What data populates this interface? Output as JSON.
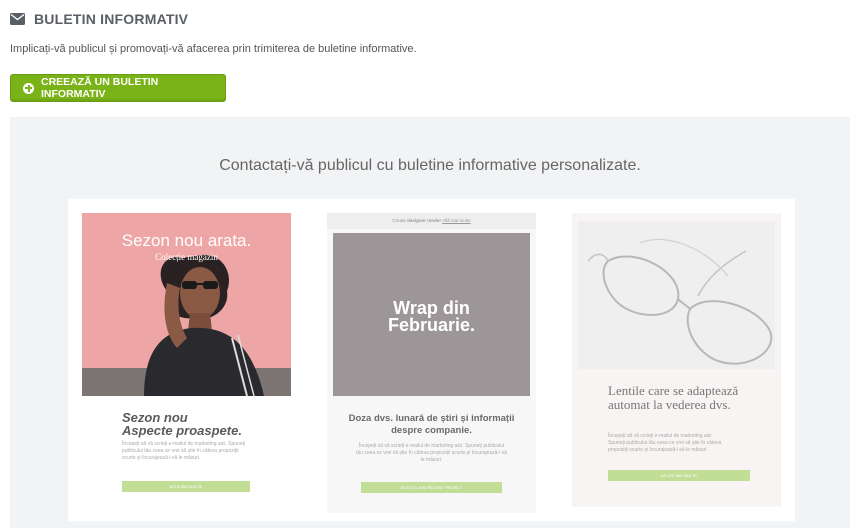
{
  "header": {
    "title": "BULETIN INFORMATIV",
    "icon": "envelope-icon"
  },
  "subtitle": "Implicați-vă publicul și promovați-vă afacerea prin trimiterea de buletine informative.",
  "create_button": {
    "label": "CREEAZĂ UN BULETIN INFORMATIV",
    "icon": "plus-circle-icon",
    "color": "#7ab317"
  },
  "promo": {
    "heading": "Contactați-vă publicul cu buletine informative personalizate.",
    "cards": [
      {
        "image_title": "Sezon nou arata.",
        "image_subtitle": "Colecție magazin",
        "headline_line1": "Sezon nou",
        "headline_line2": "Aspecte proaspete.",
        "body": "Începeți să vă scrieți e-mailul de marketing aici. Spuneți publicului tău ceea ce vrei să știe în câteva propoziții scurte și încurajează-i să le măsuri.",
        "button": "AFLA MAI MULTE",
        "image_color": "#eea5a5"
      },
      {
        "top_bar_prefix": "Create",
        "top_bar_bold": "designer render",
        "top_bar_link": "Află mai multe",
        "image_title_line1": "Wrap din",
        "image_title_line2": "Februarie.",
        "headline": "Doza dvs. lunară de știri și informații despre companie.",
        "body": "Începeți să vă scrieți e-mailul de marketing aici. Spuneți publicului tău ceea ce vrei să știe în câteva propoziții scurte și încurajează-i să le măsuri.",
        "button": "VEZI CEL MAI RECENT PROIECT",
        "image_color": "#9c9698"
      },
      {
        "headline": "Lentile care se adaptează automat la vederea dvs.",
        "body": "Începeți să vă scrieți e-mailul de marketing aici. Spuneți publicului tău ceea ce vrei să știe în câteva propoziții scurte și încurajează-i să le măsuri.",
        "button": "AFLAȚI MAI MULTE",
        "image_color": "#f0f0f0"
      }
    ]
  }
}
